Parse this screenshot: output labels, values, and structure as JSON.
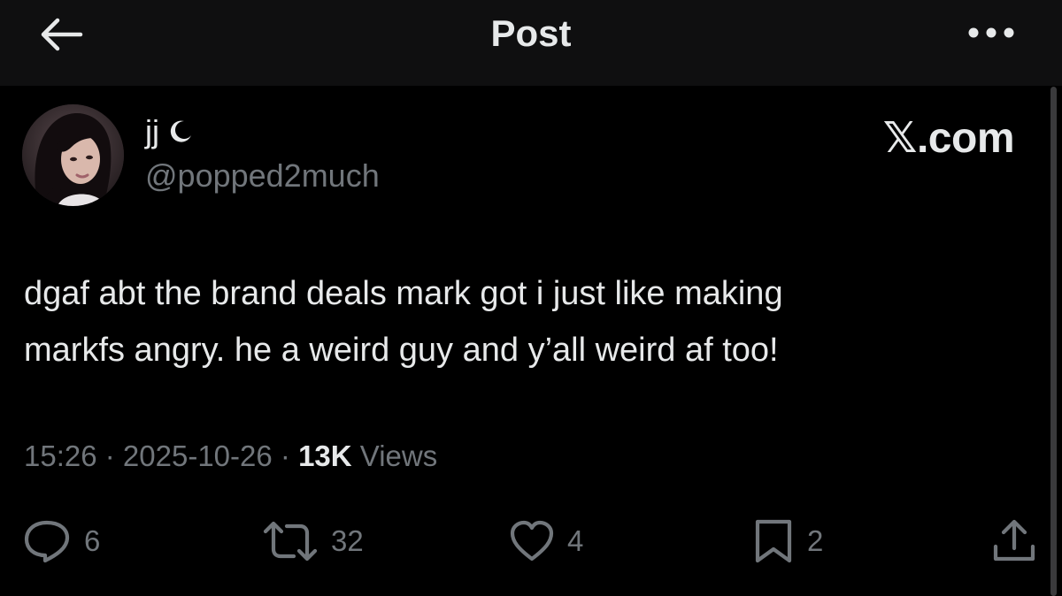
{
  "header": {
    "title": "Post",
    "back_icon": "arrow-left-icon",
    "more_icon": "more-horizontal-icon"
  },
  "author": {
    "display_name": "jj",
    "name_emoji_icon": "crescent-moon-icon",
    "handle": "@popped2much",
    "avatar_icon": "avatar"
  },
  "brand": {
    "label": "𝕏.com"
  },
  "tweet": {
    "text": "dgaf abt the brand deals mark got i just like making\nmarkfs angry. he a weird guy and y’all weird af too!"
  },
  "meta": {
    "time": "15:26",
    "separator": " · ",
    "date": "2025-10-26",
    "views_count": "13K",
    "views_label": " Views"
  },
  "actions": {
    "reply": {
      "icon": "reply-icon",
      "count": "6"
    },
    "repost": {
      "icon": "repost-icon",
      "count": "32"
    },
    "like": {
      "icon": "heart-icon",
      "count": "4"
    },
    "bookmark": {
      "icon": "bookmark-icon",
      "count": "2"
    },
    "share": {
      "icon": "share-icon"
    }
  },
  "colors": {
    "background": "#000000",
    "header_background": "#0f0f10",
    "primary_text": "#e7e9ea",
    "secondary_text": "#71767b"
  }
}
